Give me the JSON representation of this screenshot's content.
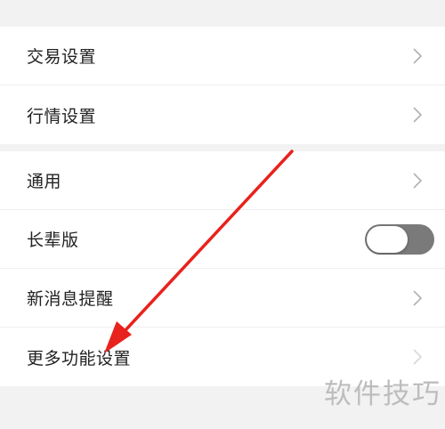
{
  "settings": {
    "group1": [
      {
        "label": "交易设置",
        "control": "chevron-right-icon"
      },
      {
        "label": "行情设置",
        "control": "chevron-right-icon"
      }
    ],
    "group2": [
      {
        "label": "通用",
        "control": "chevron-right-icon"
      },
      {
        "label": "长辈版",
        "control": "toggle",
        "toggle_on": false
      },
      {
        "label": "新消息提醒",
        "control": "chevron-right-icon"
      },
      {
        "label": "更多功能设置",
        "control": "chevron-right-icon"
      }
    ]
  },
  "annotation": {
    "arrow_color": "#e8221c",
    "arrow_icon": "red-arrow-icon"
  },
  "watermark": {
    "text": "软件技巧"
  },
  "colors": {
    "background": "#f2f2f2",
    "row_background": "#ffffff",
    "text": "#222222",
    "chevron": "#b0b0b0",
    "toggle_off": "#7a7a7a"
  }
}
